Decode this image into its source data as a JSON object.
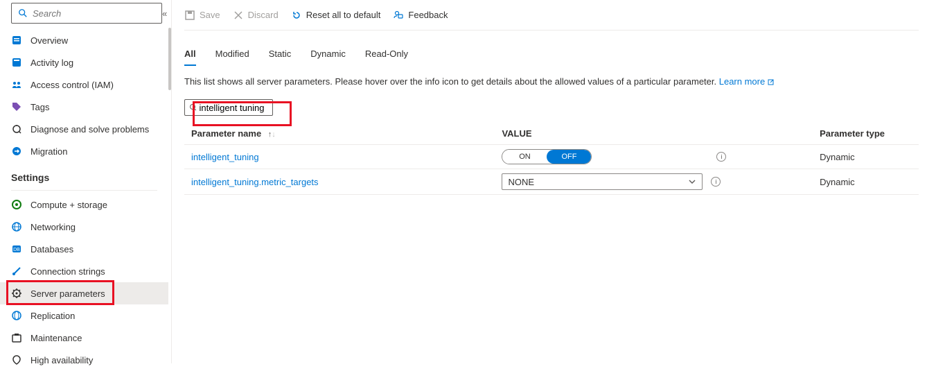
{
  "sidebar": {
    "search_placeholder": "Search",
    "nav_top": [
      {
        "label": "Overview",
        "icon": "overview"
      },
      {
        "label": "Activity log",
        "icon": "activity"
      },
      {
        "label": "Access control (IAM)",
        "icon": "iam"
      },
      {
        "label": "Tags",
        "icon": "tags"
      },
      {
        "label": "Diagnose and solve problems",
        "icon": "diagnose"
      },
      {
        "label": "Migration",
        "icon": "migration"
      }
    ],
    "settings_header": "Settings",
    "nav_settings": [
      {
        "label": "Compute + storage",
        "icon": "compute"
      },
      {
        "label": "Networking",
        "icon": "network"
      },
      {
        "label": "Databases",
        "icon": "db"
      },
      {
        "label": "Connection strings",
        "icon": "conn"
      },
      {
        "label": "Server parameters",
        "icon": "params",
        "active": true
      },
      {
        "label": "Replication",
        "icon": "replication"
      },
      {
        "label": "Maintenance",
        "icon": "maintenance"
      },
      {
        "label": "High availability",
        "icon": "ha"
      }
    ]
  },
  "toolbar": {
    "save": "Save",
    "discard": "Discard",
    "reset": "Reset all to default",
    "feedback": "Feedback"
  },
  "tabs": [
    {
      "label": "All",
      "active": true
    },
    {
      "label": "Modified"
    },
    {
      "label": "Static"
    },
    {
      "label": "Dynamic"
    },
    {
      "label": "Read-Only"
    }
  ],
  "description": {
    "text": "This list shows all server parameters. Please hover over the info icon to get details about the allowed values of a particular parameter. ",
    "learn_more": "Learn more"
  },
  "filter": {
    "value": "intelligent tuning"
  },
  "columns": {
    "name": "Parameter name",
    "value": "VALUE",
    "type": "Parameter type"
  },
  "rows": [
    {
      "name": "intelligent_tuning",
      "value_type": "toggle",
      "on_label": "ON",
      "off_label": "OFF",
      "selected": "OFF",
      "type": "Dynamic"
    },
    {
      "name": "intelligent_tuning.metric_targets",
      "value_type": "dropdown",
      "selected": "NONE",
      "type": "Dynamic"
    }
  ]
}
